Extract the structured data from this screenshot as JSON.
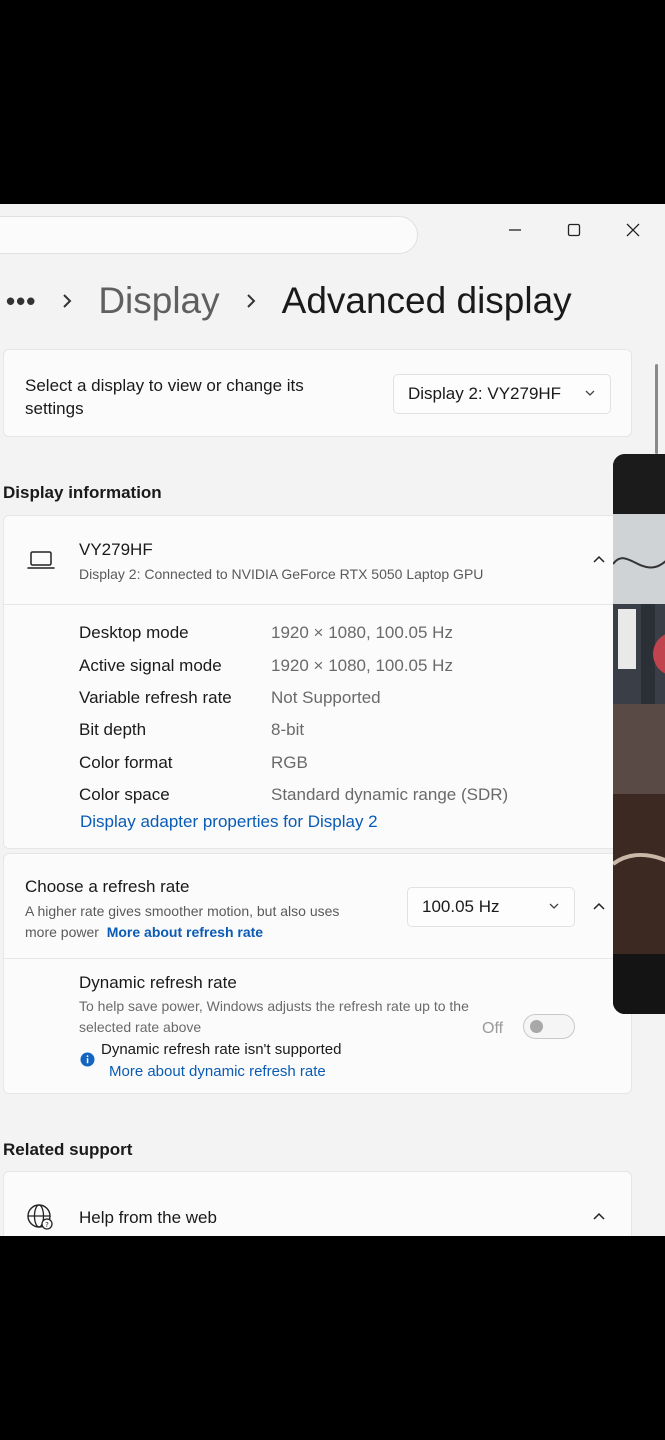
{
  "window": {
    "minimize_icon": "minimize-icon",
    "maximize_icon": "maximize-icon",
    "close_icon": "close-icon"
  },
  "breadcrumb": {
    "more": "•••",
    "parent": "Display",
    "current": "Advanced display"
  },
  "select_display": {
    "label": "Select a display to view or change its settings",
    "selected": "Display 2: VY279HF"
  },
  "display_information": {
    "heading": "Display information",
    "name": "VY279HF",
    "connection": "Display 2: Connected to NVIDIA GeForce RTX 5050 Laptop GPU",
    "rows": [
      {
        "label": "Desktop mode",
        "value": "1920 × 1080, 100.05 Hz"
      },
      {
        "label": "Active signal mode",
        "value": "1920 × 1080, 100.05 Hz"
      },
      {
        "label": "Variable refresh rate",
        "value": "Not Supported"
      },
      {
        "label": "Bit depth",
        "value": "8-bit"
      },
      {
        "label": "Color format",
        "value": "RGB"
      },
      {
        "label": "Color space",
        "value": "Standard dynamic range (SDR)"
      }
    ],
    "adapter_link": "Display adapter properties for Display 2"
  },
  "refresh_rate": {
    "title": "Choose a refresh rate",
    "description": "A higher rate gives smoother motion, but also uses more power",
    "more_link": "More about refresh rate",
    "selected": "100.05 Hz",
    "dynamic": {
      "title": "Dynamic refresh rate",
      "description": "To help save power, Windows adjusts the refresh rate up to the selected rate above",
      "toggle_state": "Off",
      "note": "Dynamic refresh rate isn't supported",
      "more_link": "More about dynamic refresh rate"
    }
  },
  "related_support": {
    "heading": "Related support",
    "item": "Help from the web"
  },
  "colors": {
    "link": "#0a5bb5",
    "background": "#f3f3f3",
    "card": "#fbfbfb",
    "info_dot": "#1565c0"
  }
}
